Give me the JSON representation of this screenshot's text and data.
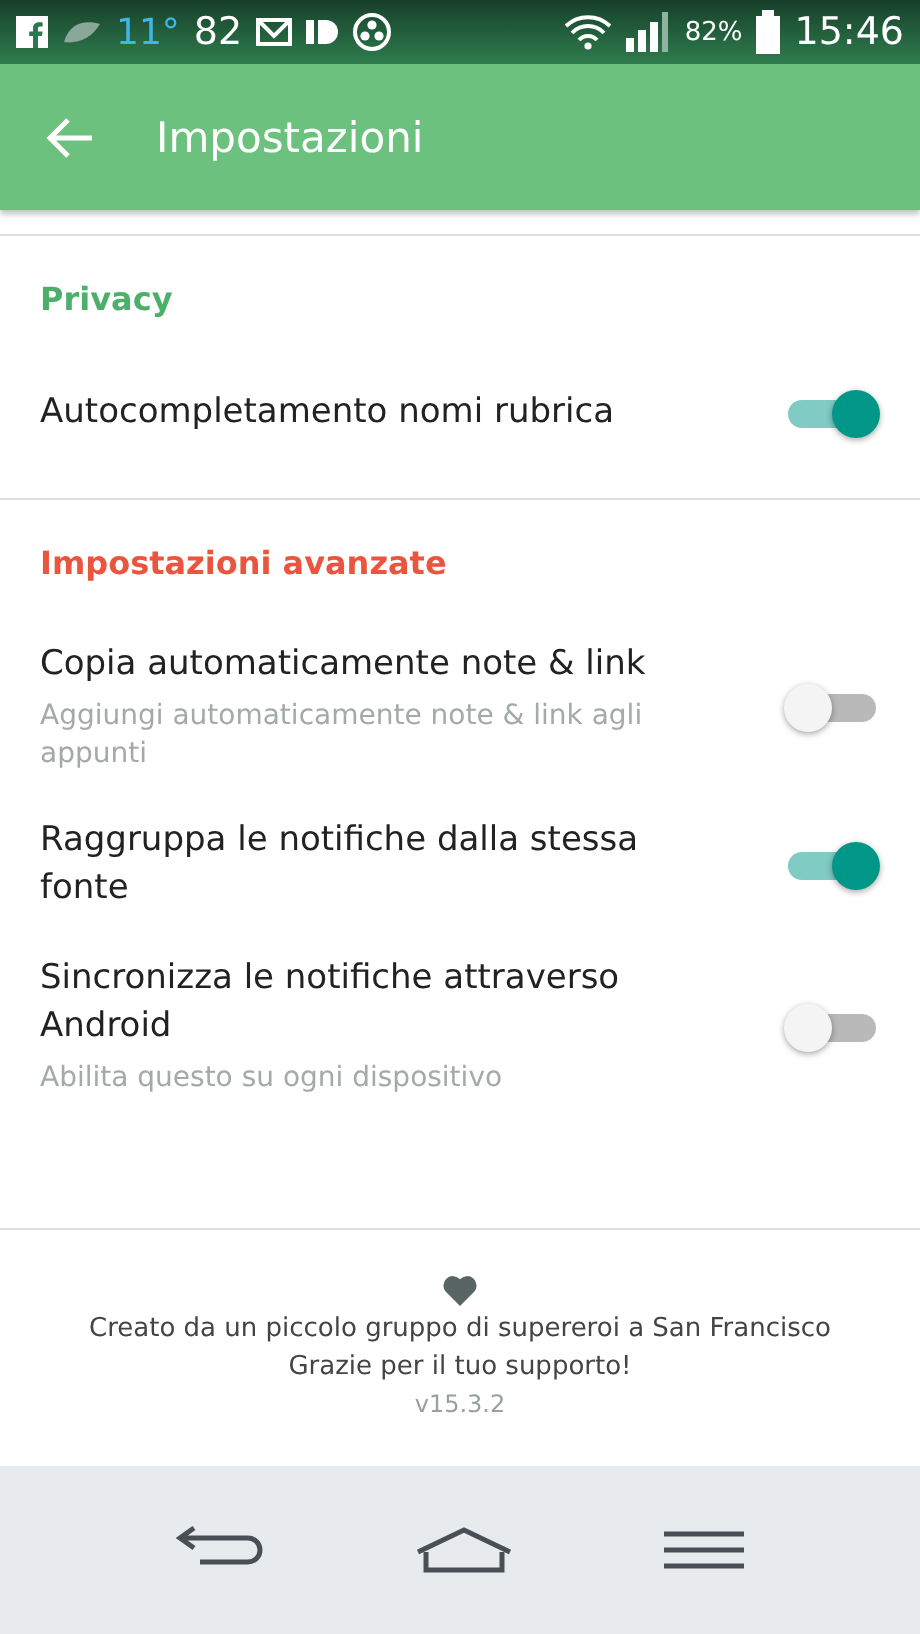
{
  "status_bar": {
    "temperature": "11°",
    "count": "82",
    "battery": "82%",
    "time": "15:46"
  },
  "app_bar": {
    "title": "Impostazioni"
  },
  "sections": [
    {
      "title": "Privacy",
      "color": "#4caf6a",
      "items": [
        {
          "label": "Autocompletamento nomi rubrica",
          "on": true
        }
      ]
    },
    {
      "title": "Impostazioni avanzate",
      "color": "#e9553f",
      "items": [
        {
          "label": "Copia automaticamente note & link",
          "summary": "Aggiungi automaticamente note & link agli appunti",
          "on": false
        },
        {
          "label": "Raggruppa le notifiche dalla stessa fonte",
          "on": true
        },
        {
          "label": "Sincronizza le notifiche attraverso Android",
          "summary": "Abilita questo su ogni dispositivo",
          "on": false
        }
      ]
    }
  ],
  "footer": {
    "credit": "Creato da un piccolo gruppo di supereroi a San Francisco",
    "thanks": "Grazie per il tuo supporto!",
    "version": "v15.3.2"
  }
}
